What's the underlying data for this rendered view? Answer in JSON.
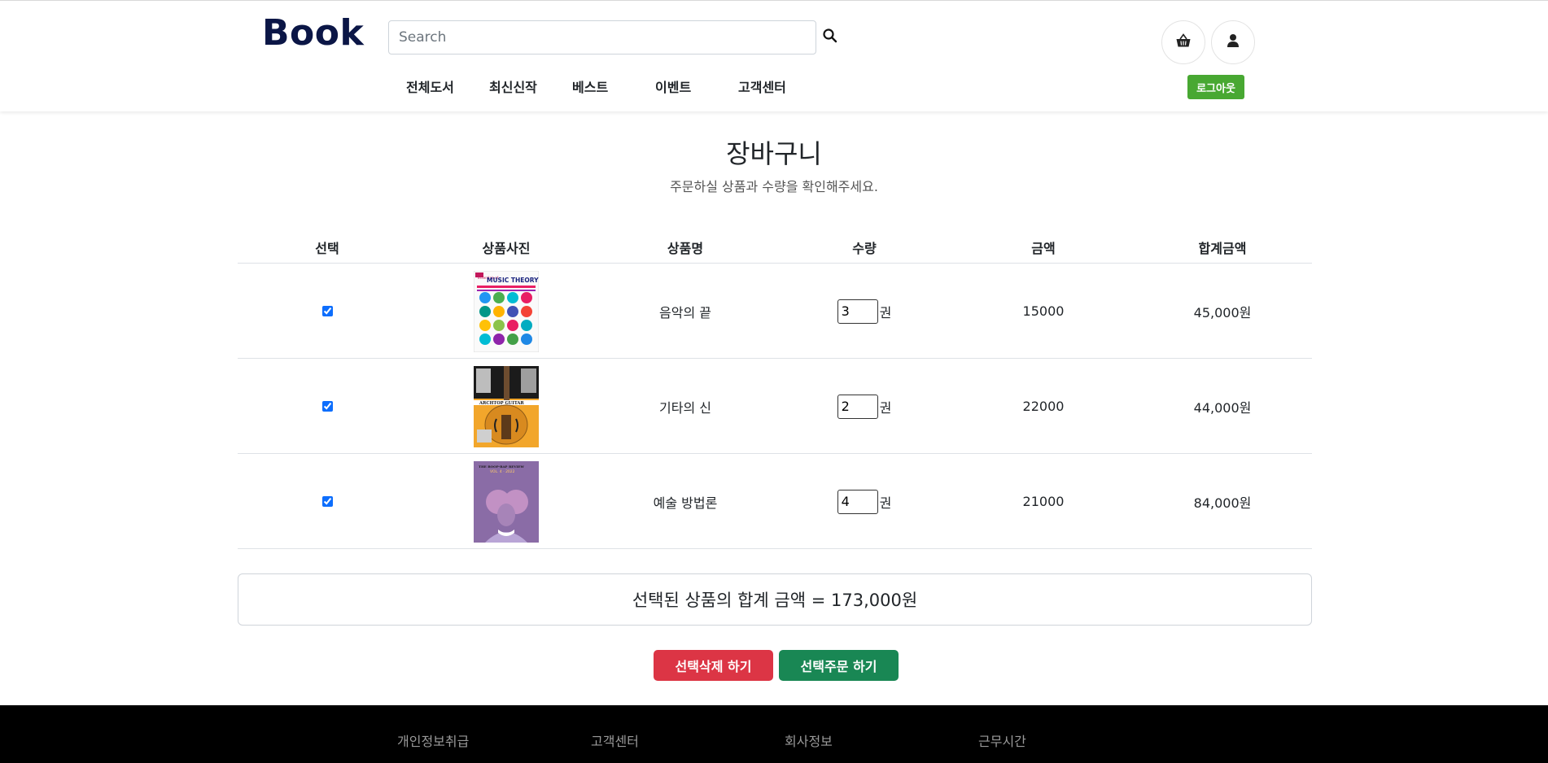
{
  "header": {
    "logo": "Book",
    "search_placeholder": "Search",
    "logout_label": "로그아웃",
    "nav": [
      "전체도서",
      "최신신작",
      "베스트",
      "이벤트",
      "고객센터"
    ]
  },
  "main": {
    "title": "장바구니",
    "subtitle": "주문하실 상품과 수량을 확인해주세요."
  },
  "table": {
    "headers": [
      "선택",
      "상품사진",
      "상품명",
      "수량",
      "금액",
      "합계금액"
    ],
    "rows": [
      {
        "checked": true,
        "name": "음악의 끝",
        "qty": "3",
        "unit": "권",
        "price": "15000",
        "total": "45,000원"
      },
      {
        "checked": true,
        "name": "기타의 신",
        "qty": "2",
        "unit": "권",
        "price": "22000",
        "total": "44,000원"
      },
      {
        "checked": true,
        "name": "예술 방법론",
        "qty": "4",
        "unit": "권",
        "price": "21000",
        "total": "84,000원"
      }
    ]
  },
  "summary": {
    "text": "선택된 상품의 합계 금액 = 173,000원"
  },
  "actions": {
    "delete_label": "선택삭제 하기",
    "order_label": "선택주문 하기"
  },
  "footer": {
    "items": [
      "개인정보취급",
      "고객센터",
      "회사정보",
      "근무시간"
    ]
  },
  "colors": {
    "logo": "#0b1646",
    "logout": "#48a832",
    "delete": "#dc3545",
    "order": "#198754",
    "footer_bg": "#000000"
  },
  "covers": [
    {
      "subtitle": "Essentials of",
      "title": "MUSIC THEORY"
    },
    {
      "subtitle": "",
      "title": "ARCHTOP GUITAR"
    },
    {
      "subtitle": "THE BOOP-BAP REVIEW",
      "title": "VOL. 4 · 2022"
    }
  ]
}
